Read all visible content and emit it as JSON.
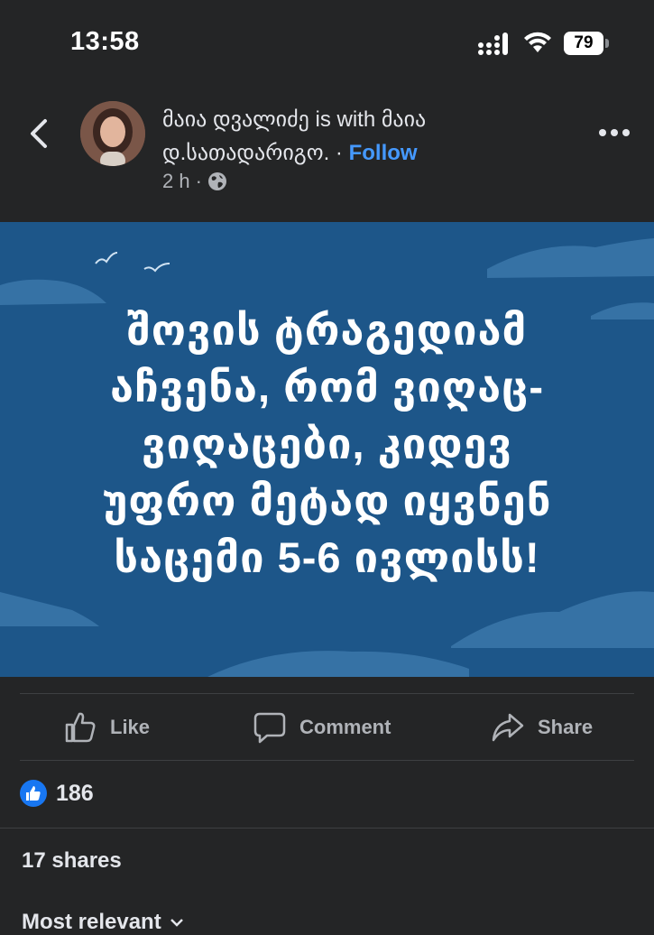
{
  "status_bar": {
    "time": "13:58",
    "battery": "79"
  },
  "post": {
    "author": "მაია დვალიძე",
    "with_text": "is with",
    "tagged": "მაია დ.სათადარიგო.",
    "separator": "·",
    "follow_label": "Follow",
    "time_ago": "2 h",
    "meta_separator": "·",
    "privacy_icon": "globe-icon"
  },
  "image": {
    "background_color": "#1d5689",
    "lines": [
      "შოვის ტრაგედიამ",
      "აჩვენა, რომ ვიღაც-",
      "ვიღაცები, კიდევ",
      "უფრო მეტად იყვნენ",
      "საცემი 5-6 ივლისს!"
    ]
  },
  "actions": {
    "like_label": "Like",
    "comment_label": "Comment",
    "share_label": "Share"
  },
  "reactions": {
    "count": "186"
  },
  "shares": "17 shares",
  "sort_label": "Most relevant"
}
